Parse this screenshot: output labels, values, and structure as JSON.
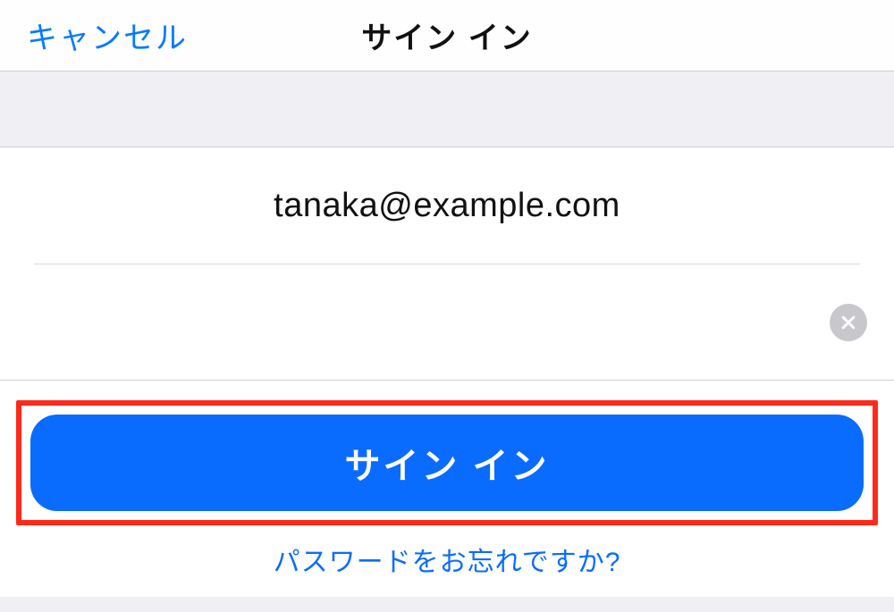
{
  "nav": {
    "cancel_label": "キャンセル",
    "title": "サイン イン"
  },
  "form": {
    "email_value": "tanaka@example.com",
    "password_value": "",
    "clear_icon": "clear-icon"
  },
  "action": {
    "signin_label": "サイン イン"
  },
  "links": {
    "forgot_password": "パスワードをお忘れですか?"
  },
  "colors": {
    "accent_blue": "#007aff",
    "button_blue": "#0a6cff",
    "highlight_red": "#ff2a1a",
    "clear_gray": "#c7c7cc"
  }
}
